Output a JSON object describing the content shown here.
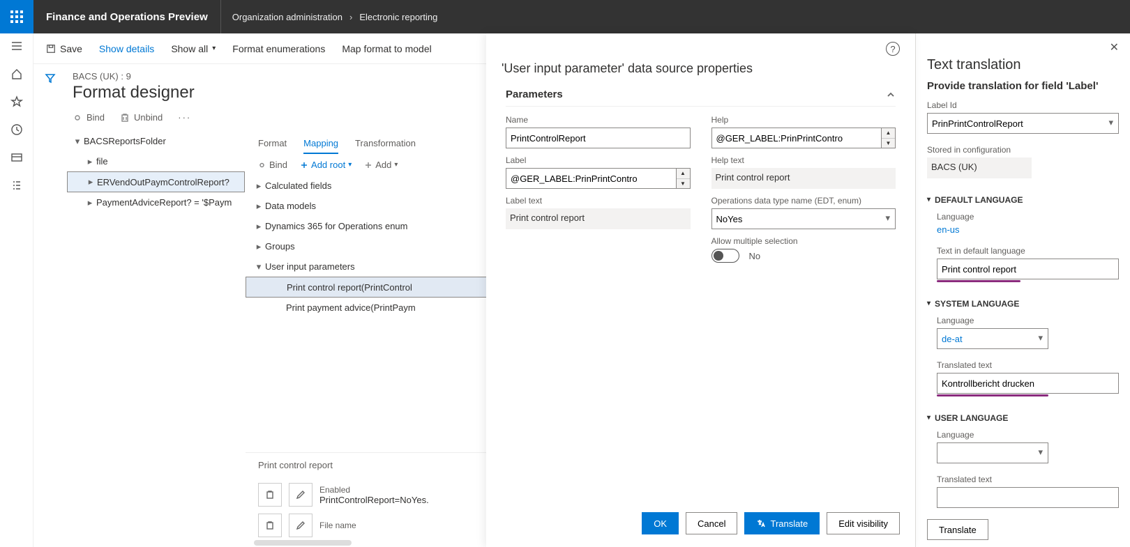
{
  "header": {
    "appTitle": "Finance and Operations Preview",
    "breadcrumb": [
      "Organization administration",
      "Electronic reporting"
    ]
  },
  "actionbar": {
    "save": "Save",
    "showDetails": "Show details",
    "showAll": "Show all",
    "formatEnum": "Format enumerations",
    "mapFormat": "Map format to model"
  },
  "page": {
    "context": "BACS (UK) : 9",
    "title": "Format designer"
  },
  "leftTree": {
    "toolbar": {
      "bind": "Bind",
      "unbind": "Unbind"
    },
    "items": [
      {
        "label": "BACSReportsFolder",
        "expander": "▾",
        "indent": 0
      },
      {
        "label": "file",
        "expander": "▸",
        "indent": 1
      },
      {
        "label": "ERVendOutPaymControlReport?",
        "expander": "▸",
        "indent": 1,
        "selected": true
      },
      {
        "label": "PaymentAdviceReport? = '$Paym",
        "expander": "▸",
        "indent": 1
      }
    ]
  },
  "midTabs": [
    "Format",
    "Mapping",
    "Transformation"
  ],
  "midActive": 1,
  "midTool": {
    "bind": "Bind",
    "addRoot": "Add root",
    "add": "Add"
  },
  "midTree": [
    {
      "label": "Calculated fields",
      "expander": "▸",
      "indent": 0
    },
    {
      "label": "Data models",
      "expander": "▸",
      "indent": 0
    },
    {
      "label": "Dynamics 365 for Operations enum",
      "expander": "▸",
      "indent": 0
    },
    {
      "label": "Groups",
      "expander": "▸",
      "indent": 0
    },
    {
      "label": "User input parameters",
      "expander": "▾",
      "indent": 0
    },
    {
      "label": "Print control report(PrintControl",
      "expander": "",
      "indent": 1,
      "selected": true
    },
    {
      "label": "Print payment advice(PrintPaym",
      "expander": "",
      "indent": 1
    }
  ],
  "lowbox": {
    "title": "Print control report",
    "rows": [
      {
        "k": "Enabled",
        "v": "PrintControlReport=NoYes."
      },
      {
        "k": "File name",
        "v": ""
      }
    ]
  },
  "flyout": {
    "title": "'User input parameter' data source properties",
    "section": "Parameters",
    "fields": {
      "nameLabel": "Name",
      "name": "PrintControlReport",
      "labelLabel": "Label",
      "label": "@GER_LABEL:PrinPrintContro",
      "labelTextLabel": "Label text",
      "labelText": "Print control report",
      "helpLabel": "Help",
      "help": "@GER_LABEL:PrinPrintContro",
      "helpTextLabel": "Help text",
      "helpText": "Print control report",
      "edtLabel": "Operations data type name (EDT, enum)",
      "edt": "NoYes",
      "multiLabel": "Allow multiple selection",
      "multi": "No"
    },
    "buttons": {
      "ok": "OK",
      "cancel": "Cancel",
      "translate": "Translate",
      "edit": "Edit visibility"
    }
  },
  "rpanel": {
    "title": "Text translation",
    "sub": "Provide translation for field 'Label'",
    "labelIdLabel": "Label Id",
    "labelId": "PrinPrintControlReport",
    "storedLabel": "Stored in configuration",
    "stored": "BACS (UK)",
    "sections": {
      "default": {
        "hdr": "DEFAULT LANGUAGE",
        "langLabel": "Language",
        "lang": "en-us",
        "textLabel": "Text in default language",
        "text": "Print control report"
      },
      "system": {
        "hdr": "SYSTEM LANGUAGE",
        "langLabel": "Language",
        "lang": "de-at",
        "textLabel": "Translated text",
        "text": "Kontrollbericht drucken"
      },
      "user": {
        "hdr": "USER LANGUAGE",
        "langLabel": "Language",
        "lang": "",
        "textLabel": "Translated text",
        "text": ""
      }
    },
    "translateBtn": "Translate"
  }
}
